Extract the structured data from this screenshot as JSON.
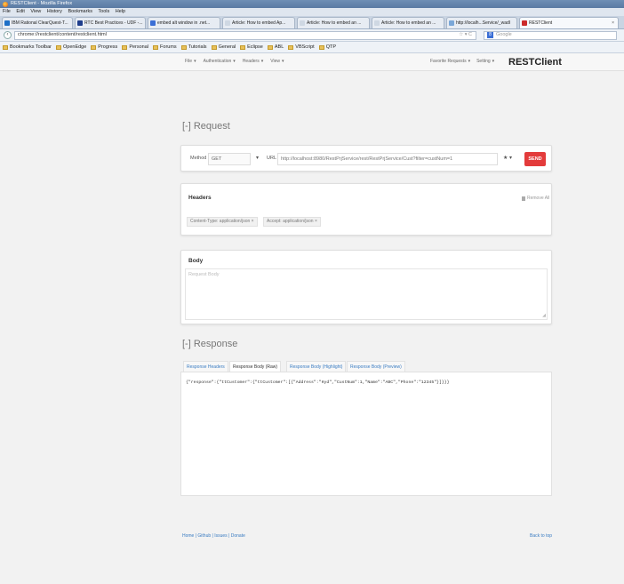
{
  "window": {
    "title": "RESTClient - Mozilla Firefox"
  },
  "menubar": {
    "items": [
      "File",
      "Edit",
      "View",
      "History",
      "Bookmarks",
      "Tools",
      "Help"
    ]
  },
  "tabs": [
    {
      "label": "IBM Rational ClearQuest-T...",
      "color": "#1e6fc7"
    },
    {
      "label": "RTC Best Practices - UDF -...",
      "color": "#1e3d8c"
    },
    {
      "label": "embed alt window in .net...",
      "color": "#3b6fd6"
    },
    {
      "label": "Article: How to embed Ap...",
      "color": "#cfd8e3"
    },
    {
      "label": "Article: How to embed an ...",
      "color": "#cfd8e3"
    },
    {
      "label": "Article: How to embed an ...",
      "color": "#cfd8e3"
    },
    {
      "label": "http://localh...Service/_wadl",
      "color": "#7aa7d8"
    },
    {
      "label": "RESTClient",
      "color": "#cc2a2a"
    }
  ],
  "navbar": {
    "url": "chrome://restclient/content/restclient.html",
    "search_placeholder": "Google"
  },
  "bookmarks": [
    "Bookmarks Toolbar",
    "OpenEdge",
    "Progress",
    "Personal",
    "Forums",
    "Tutorials",
    "General",
    "Eclipse",
    "ABL",
    "VBScript",
    "QTP"
  ],
  "app": {
    "menu": [
      "File",
      "Authentication",
      "Headers",
      "View"
    ],
    "right_menu": [
      "Favorite Requests",
      "Setting"
    ],
    "brand": "RESTClient"
  },
  "request": {
    "section_title": "[-] Request",
    "method_label": "Method",
    "method_value": "GET",
    "url_label": "URL",
    "url_value": "http://localhost:8980/RestPrjService/rest/RestPrjService/Cust?filter=custNum=1",
    "send_label": "SEND"
  },
  "headers": {
    "title": "Headers",
    "remove_all": "Remove All",
    "chips": [
      "Content-Type: application/json",
      "Accept: application/json"
    ]
  },
  "body": {
    "title": "Body",
    "placeholder": "Request Body"
  },
  "response": {
    "section_title": "[-] Response",
    "tabs": [
      "Response Headers",
      "Response Body (Raw)",
      "Response Body (Highlight)",
      "Response Body (Preview)"
    ],
    "active_tab": 1,
    "raw": "{\"response\":{\"ttCustomer\":{\"ttCustomer\":[{\"Address\":\"Hyd\",\"CustNum\":1,\"Name\":\"ABC\",\"Phone\":\"12345\"}]}}}"
  },
  "footer": {
    "links": "Home | Github | Issues | Donate",
    "back_to_top": "Back to top"
  },
  "colors": {
    "send": "#e33b3b",
    "link": "#3a7cc2"
  }
}
